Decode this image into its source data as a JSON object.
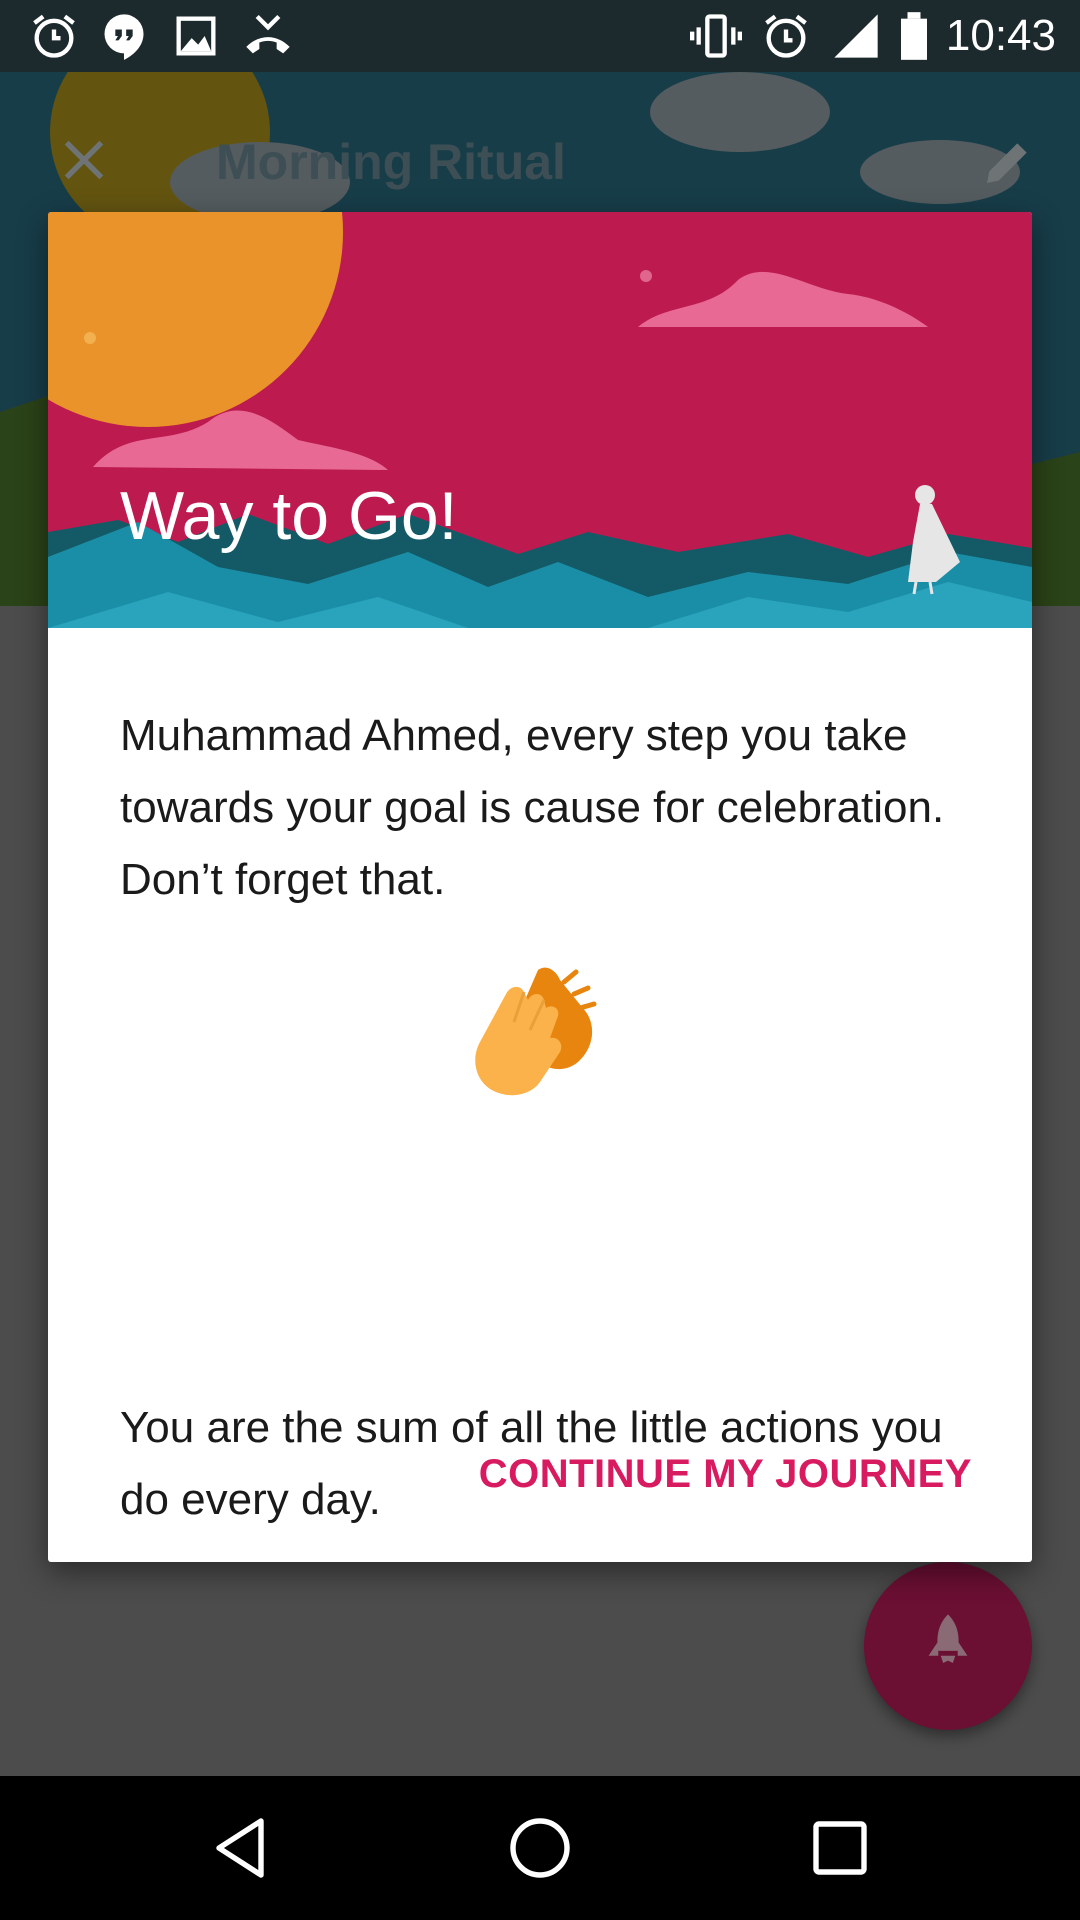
{
  "status_bar": {
    "time": "10:43",
    "left_icons": [
      "alarm-clock-icon",
      "hangouts-icon",
      "image-icon",
      "missed-call-icon"
    ],
    "right_icons": [
      "vibrate-icon",
      "alarm-icon",
      "signal-icon",
      "battery-icon"
    ]
  },
  "background_app": {
    "title": "Morning Ritual",
    "close_icon": "close-icon",
    "edit_icon": "pencil-icon",
    "fab_icon": "rocket-icon"
  },
  "dialog": {
    "title": "Way to Go!",
    "message": "Muhammad Ahmed, every step you take towards your goal is cause for celebration. Don’t forget that.",
    "emoji": "clapping-hands-icon",
    "quote": "You are the sum of all the little actions you do every day.",
    "action_label": "CONTINUE MY JOURNEY",
    "colors": {
      "header": "#bd1a50",
      "action": "#d81b60",
      "sun": "#e8901e",
      "mountains": "#1a8ea6"
    }
  },
  "nav_bar": {
    "buttons": [
      "back-icon",
      "home-icon",
      "recents-icon"
    ]
  }
}
